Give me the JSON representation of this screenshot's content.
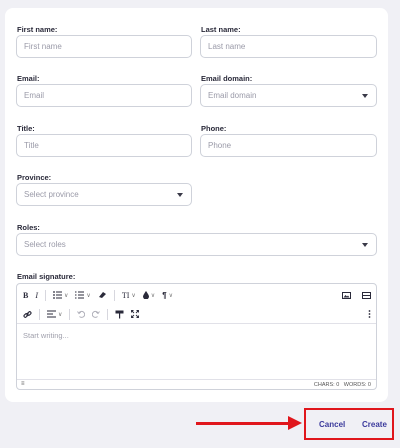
{
  "form": {
    "first_name": {
      "label": "First name:",
      "placeholder": "First name"
    },
    "last_name": {
      "label": "Last name:",
      "placeholder": "Last name"
    },
    "email": {
      "label": "Email:",
      "placeholder": "Email"
    },
    "email_domain": {
      "label": "Email domain:",
      "placeholder": "Email domain"
    },
    "title": {
      "label": "Title:",
      "placeholder": "Title"
    },
    "phone": {
      "label": "Phone:",
      "placeholder": "Phone"
    },
    "province": {
      "label": "Province:",
      "placeholder": "Select province"
    },
    "roles": {
      "label": "Roles:",
      "placeholder": "Select roles"
    },
    "signature": {
      "label": "Email signature:",
      "placeholder": "Start writing...",
      "chars": "CHARS: 0",
      "words": "WORDS: 0"
    }
  },
  "toolbar": {
    "bold": "B",
    "italic": "I",
    "text_size": "TI",
    "paragraph": "¶"
  },
  "actions": {
    "cancel": "Cancel",
    "create": "Create"
  },
  "annotation_color": "#e0161c"
}
